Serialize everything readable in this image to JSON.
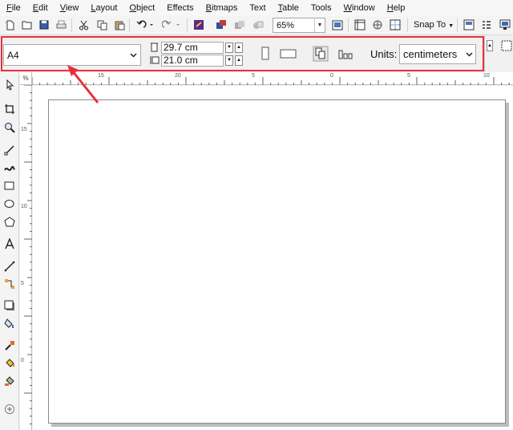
{
  "menu": [
    "File",
    "Edit",
    "View",
    "Layout",
    "Object",
    "Effects",
    "Bitmaps",
    "Text",
    "Table",
    "Tools",
    "Window",
    "Help"
  ],
  "toolbar": {
    "zoom_level": "65%",
    "snap_label": "Snap To"
  },
  "property_bar": {
    "page_preset": "A4",
    "width_value": "29.7 cm",
    "height_value": "21.0 cm",
    "units_label": "Units:",
    "units_value": "centimeters"
  },
  "rulers": {
    "corner_label": "%",
    "horizontal_labels": [
      "15",
      "20",
      "5",
      "0",
      "5",
      "10"
    ],
    "vertical_labels": [
      "15",
      "10",
      "5",
      "0"
    ]
  },
  "colors": {
    "highlight": "#e8303c",
    "arrow": "#e8303c",
    "page_border": "#8a8a8a",
    "page_shadow": "#bcbcbc"
  }
}
